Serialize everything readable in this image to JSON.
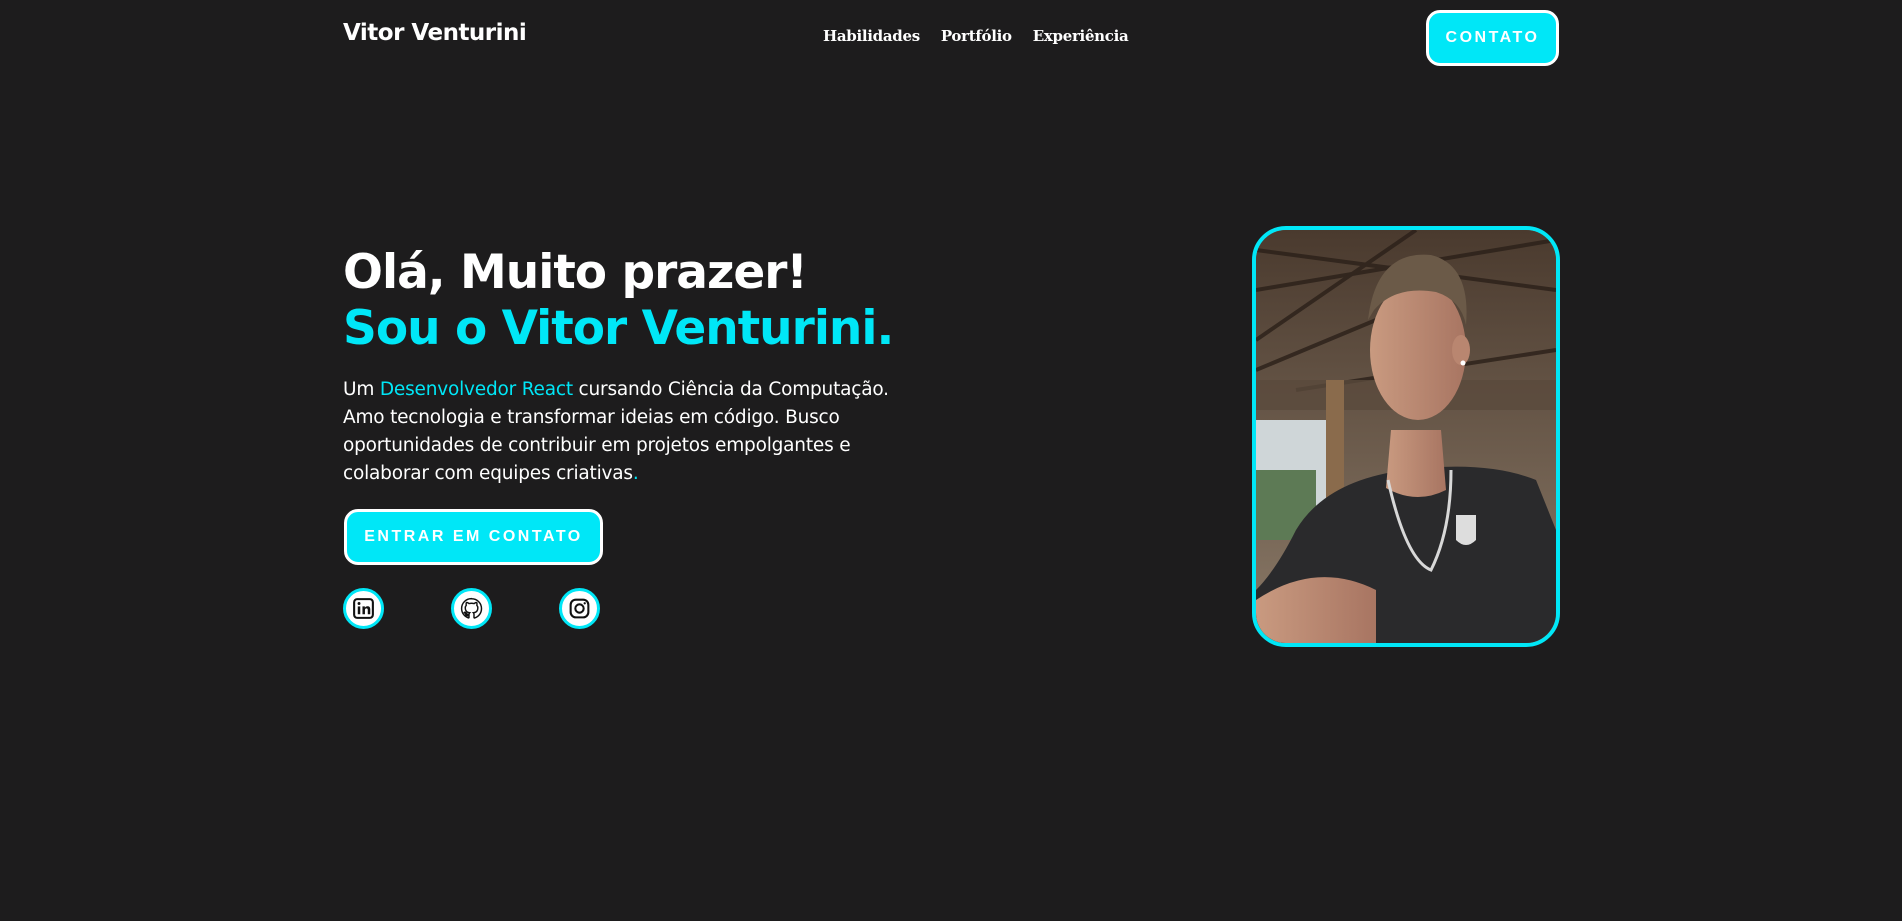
{
  "header": {
    "brand": "Vitor Venturini",
    "nav": [
      "Habilidades",
      "Portfólio",
      "Experiência"
    ],
    "contact_button": "CONTATO"
  },
  "hero": {
    "title_line1": "Olá, Muito prazer!",
    "title_line2": "Sou o Vitor Venturini.",
    "desc_prefix": "Um ",
    "desc_highlight": "Desenvolvedor React",
    "desc_rest": " cursando Ciência da Computação. Amo tecnologia e transformar ideias em código. Busco oportunidades de contribuir em projetos empolgantes e colaborar com equipes criativas",
    "desc_period": ".",
    "cta_label": "ENTRAR EM CONTATO"
  },
  "socials": [
    {
      "name": "linkedin",
      "icon": "linkedin-icon"
    },
    {
      "name": "github",
      "icon": "github-icon"
    },
    {
      "name": "instagram",
      "icon": "instagram-icon"
    }
  ],
  "colors": {
    "background": "#1d1c1d",
    "accent": "#00e7f7",
    "text": "#ffffff"
  }
}
